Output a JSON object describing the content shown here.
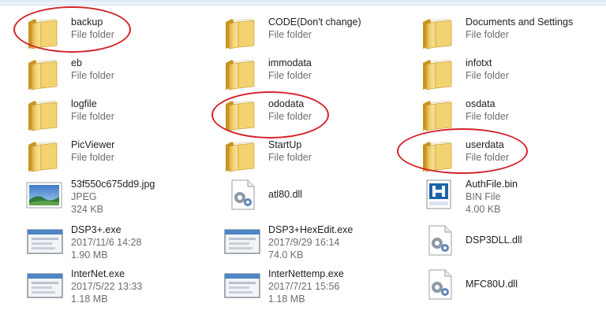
{
  "annotation_color": "#d4232a",
  "files": [
    {
      "name": "backup",
      "line2": "File folder",
      "line3": "",
      "icon": "folder-icon"
    },
    {
      "name": "CODE(Don't change)",
      "line2": "File folder",
      "line3": "",
      "icon": "folder-icon"
    },
    {
      "name": "Documents and Settings",
      "line2": "File folder",
      "line3": "",
      "icon": "folder-icon"
    },
    {
      "name": "eb",
      "line2": "File folder",
      "line3": "",
      "icon": "folder-icon"
    },
    {
      "name": "immodata",
      "line2": "File folder",
      "line3": "",
      "icon": "folder-icon"
    },
    {
      "name": "infotxt",
      "line2": "File folder",
      "line3": "",
      "icon": "folder-icon"
    },
    {
      "name": "logfile",
      "line2": "File folder",
      "line3": "",
      "icon": "folder-icon"
    },
    {
      "name": "ododata",
      "line2": "File folder",
      "line3": "",
      "icon": "folder-icon"
    },
    {
      "name": "osdata",
      "line2": "File folder",
      "line3": "",
      "icon": "folder-icon"
    },
    {
      "name": "PicViewer",
      "line2": "File folder",
      "line3": "",
      "icon": "folder-icon"
    },
    {
      "name": "StartUp",
      "line2": "File folder",
      "line3": "",
      "icon": "folder-icon"
    },
    {
      "name": "userdata",
      "line2": "File folder",
      "line3": "",
      "icon": "folder-icon"
    },
    {
      "name": "53f550c675dd9.jpg",
      "line2": "JPEG",
      "line3": "324 KB",
      "icon": "jpeg-image-icon"
    },
    {
      "name": "atl80.dll",
      "line2": "",
      "line3": "",
      "icon": "dll-gear-icon"
    },
    {
      "name": "AuthFile.bin",
      "line2": "BIN File",
      "line3": "4.00 KB",
      "icon": "bin-file-icon"
    },
    {
      "name": "DSP3+.exe",
      "line2": "2017/11/6 14:28",
      "line3": "1.90 MB",
      "icon": "exe-window-icon"
    },
    {
      "name": "DSP3+HexEdit.exe",
      "line2": "2017/9/29 16:14",
      "line3": "74.0 KB",
      "icon": "exe-window-icon"
    },
    {
      "name": "DSP3DLL.dll",
      "line2": "",
      "line3": "",
      "icon": "dll-gear-icon"
    },
    {
      "name": "InterNet.exe",
      "line2": "2017/5/22 13:33",
      "line3": "1.18 MB",
      "icon": "exe-window-icon"
    },
    {
      "name": "InterNettemp.exe",
      "line2": "2017/7/21 15:56",
      "line3": "1.18 MB",
      "icon": "exe-window-icon"
    },
    {
      "name": "MFC80U.dll",
      "line2": "",
      "line3": "",
      "icon": "dll-gear-icon"
    }
  ]
}
